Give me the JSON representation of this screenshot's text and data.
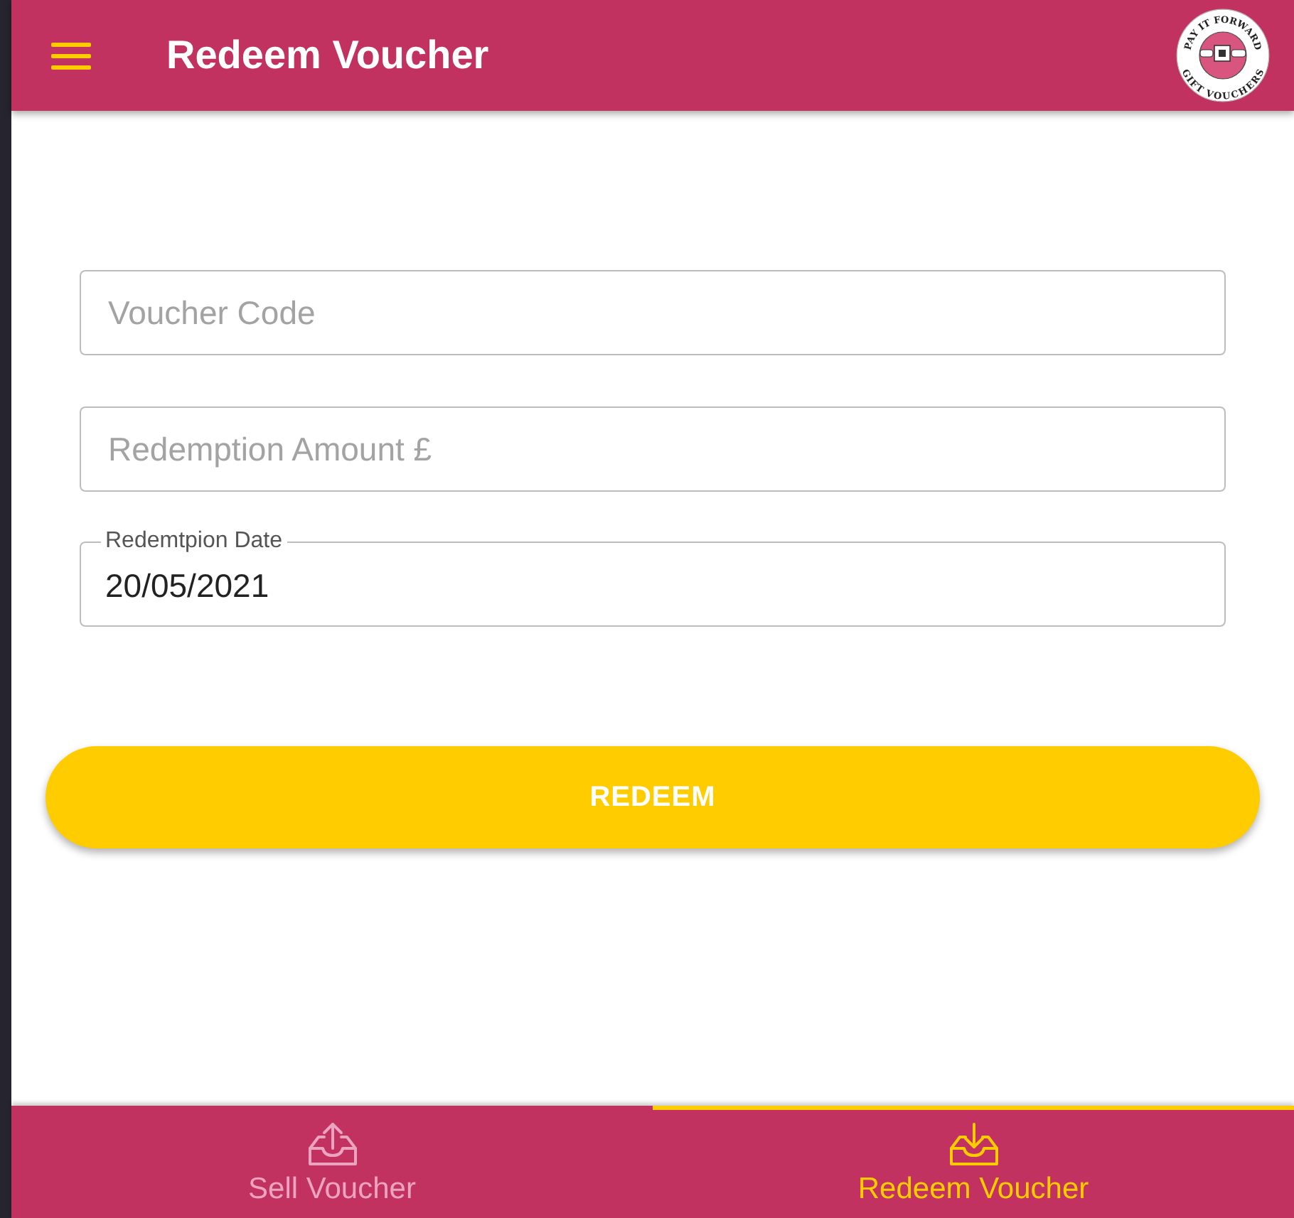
{
  "app_bar": {
    "title": "Redeem Voucher",
    "logo": {
      "top_text": "PAY IT FORWARD",
      "bottom_text": "GIFT VOUCHERS"
    }
  },
  "form": {
    "fields": [
      {
        "kind": "plain",
        "placeholder": "Voucher Code"
      },
      {
        "kind": "plain",
        "placeholder": "Redemption Amount £"
      },
      {
        "kind": "floating",
        "label": "Redemtpion Date",
        "value": "20/05/2021"
      }
    ],
    "submit": "REDEEM"
  },
  "bottom_nav": [
    {
      "label": "Sell Voucher",
      "selected": false
    },
    {
      "label": "Redeem Voucher",
      "selected": true
    }
  ]
}
